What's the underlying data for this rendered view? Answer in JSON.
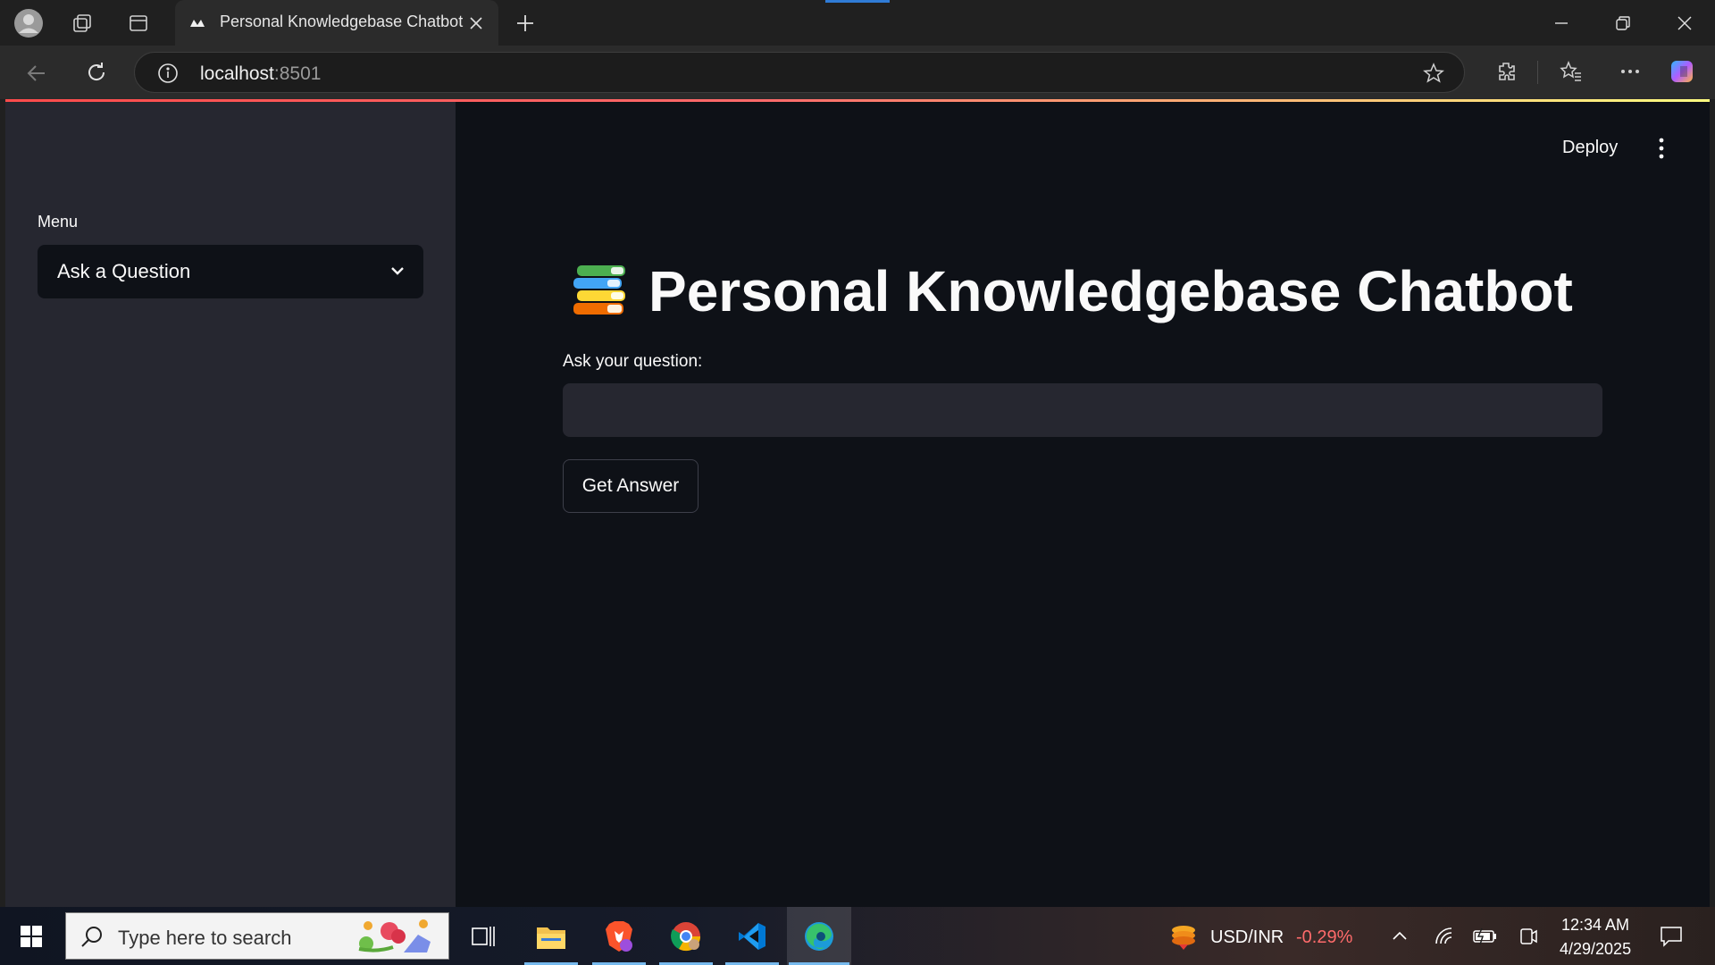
{
  "browser": {
    "tab_title": "Personal Knowledgebase Chatbot",
    "address_host": "localhost",
    "address_port": ":8501"
  },
  "sidebar": {
    "menu_label": "Menu",
    "selected": "Ask a Question"
  },
  "header": {
    "deploy_label": "Deploy"
  },
  "main": {
    "title": "Personal Knowledgebase Chatbot",
    "question_label": "Ask your question:",
    "question_value": "",
    "button_label": "Get Answer"
  },
  "taskbar": {
    "search_placeholder": "Type here to search",
    "ticker_name": "USD/INR",
    "ticker_change": "-0.29%",
    "time": "12:34 AM",
    "date": "4/29/2025"
  },
  "colors": {
    "accent_red": "#ff4b4b",
    "app_bg": "#0e1117",
    "sidebar_bg": "#262730",
    "ticker_negative": "#ff6b6b"
  }
}
